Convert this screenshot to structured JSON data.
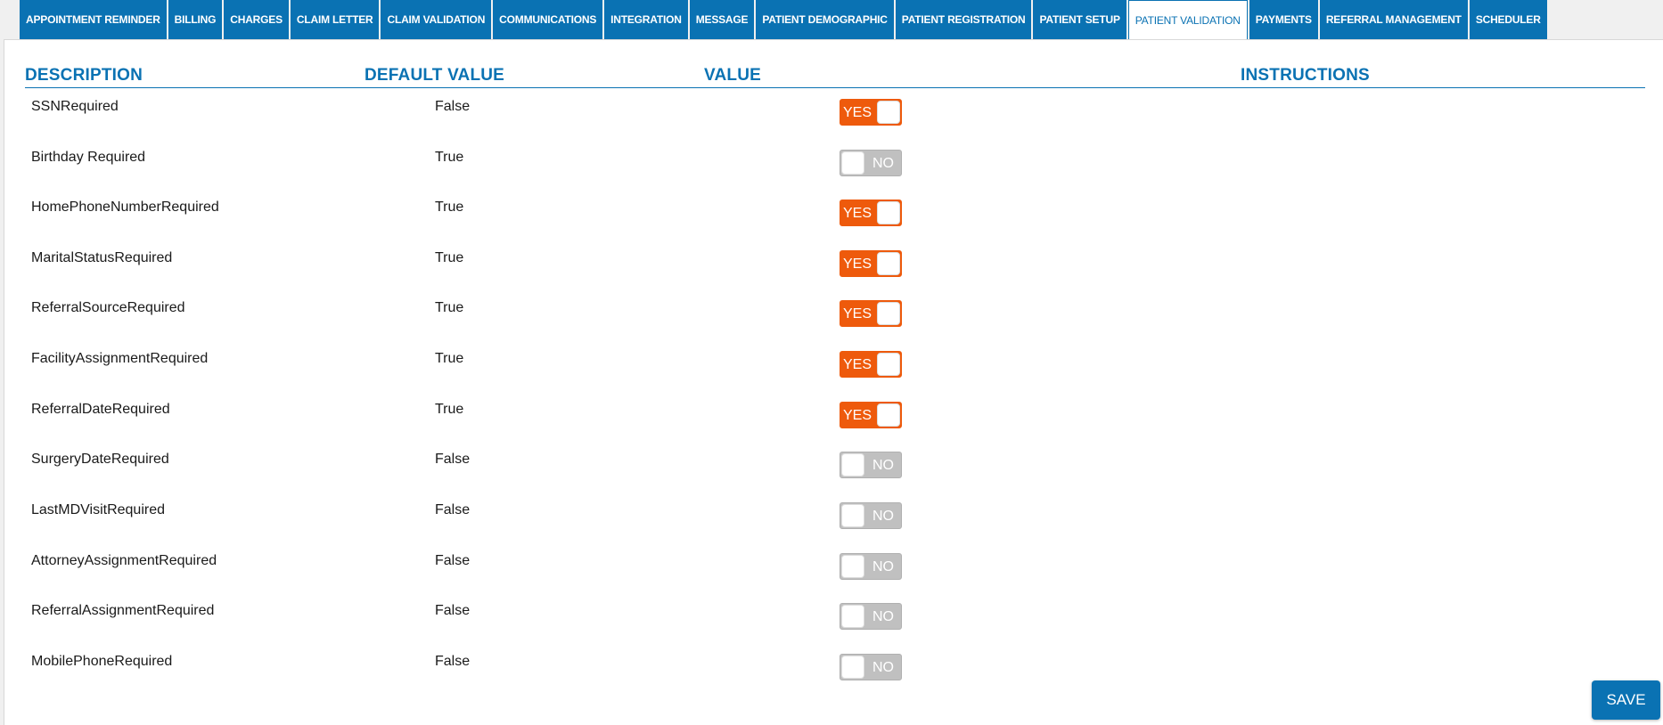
{
  "tabs": [
    {
      "label": "APPOINTMENT REMINDER",
      "active": false
    },
    {
      "label": "BILLING",
      "active": false
    },
    {
      "label": "CHARGES",
      "active": false
    },
    {
      "label": "CLAIM LETTER",
      "active": false
    },
    {
      "label": "CLAIM VALIDATION",
      "active": false
    },
    {
      "label": "COMMUNICATIONS",
      "active": false
    },
    {
      "label": "INTEGRATION",
      "active": false
    },
    {
      "label": "MESSAGE",
      "active": false
    },
    {
      "label": "PATIENT DEMOGRAPHIC",
      "active": false
    },
    {
      "label": "PATIENT REGISTRATION",
      "active": false
    },
    {
      "label": "PATIENT SETUP",
      "active": false
    },
    {
      "label": "PATIENT VALIDATION",
      "active": true
    },
    {
      "label": "PAYMENTS",
      "active": false
    },
    {
      "label": "REFERRAL MANAGEMENT",
      "active": false
    },
    {
      "label": "SCHEDULER",
      "active": false
    }
  ],
  "table": {
    "headers": {
      "description": "DESCRIPTION",
      "default_value": "DEFAULT VALUE",
      "value": "VALUE",
      "instructions": "INSTRUCTIONS"
    },
    "rows": [
      {
        "description": "SSNRequired",
        "default_value": "False",
        "value": true,
        "value_label": "YES"
      },
      {
        "description": "Birthday Required",
        "default_value": "True",
        "value": false,
        "value_label": "NO"
      },
      {
        "description": "HomePhoneNumberRequired",
        "default_value": "True",
        "value": true,
        "value_label": "YES"
      },
      {
        "description": "MaritalStatusRequired",
        "default_value": "True",
        "value": true,
        "value_label": "YES"
      },
      {
        "description": "ReferralSourceRequired",
        "default_value": "True",
        "value": true,
        "value_label": "YES"
      },
      {
        "description": "FacilityAssignmentRequired",
        "default_value": "True",
        "value": true,
        "value_label": "YES"
      },
      {
        "description": "ReferralDateRequired",
        "default_value": "True",
        "value": true,
        "value_label": "YES"
      },
      {
        "description": "SurgeryDateRequired",
        "default_value": "False",
        "value": false,
        "value_label": "NO"
      },
      {
        "description": "LastMDVisitRequired",
        "default_value": "False",
        "value": false,
        "value_label": "NO"
      },
      {
        "description": "AttorneyAssignmentRequired",
        "default_value": "False",
        "value": false,
        "value_label": "NO"
      },
      {
        "description": "ReferralAssignmentRequired",
        "default_value": "False",
        "value": false,
        "value_label": "NO"
      },
      {
        "description": "MobilePhoneRequired",
        "default_value": "False",
        "value": false,
        "value_label": "NO"
      }
    ]
  },
  "save_label": "SAVE",
  "colors": {
    "primary": "#0a72b3",
    "toggle_on": "#ee5a0c",
    "toggle_off": "#c0c0c0"
  }
}
